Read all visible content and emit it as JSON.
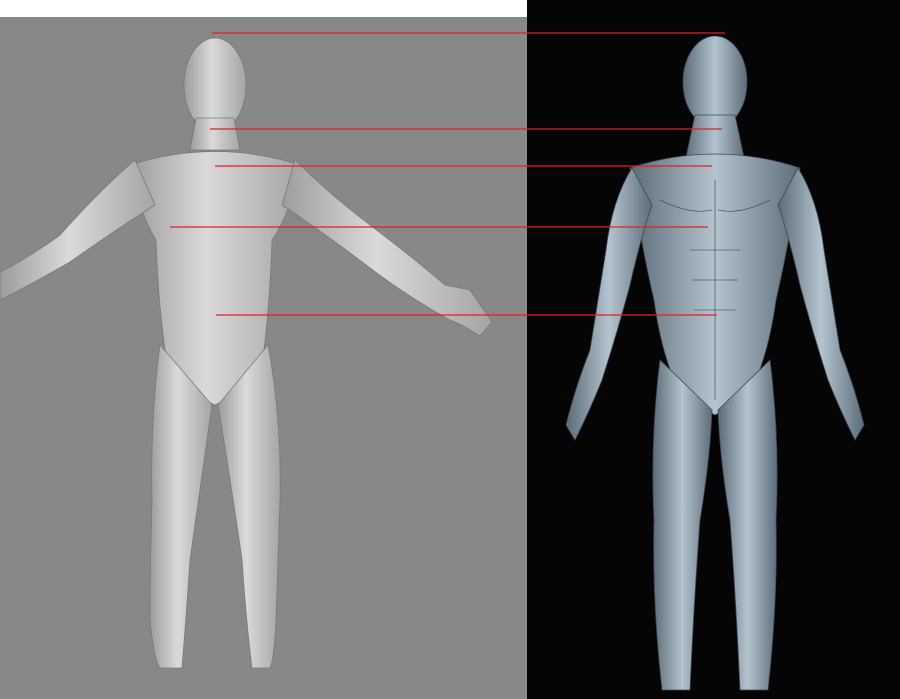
{
  "colors": {
    "left_background": "#888888",
    "left_frame": "#ffffff",
    "right_background": "#050505",
    "reference_line": "#e02020",
    "base_mesh_skin": "#c4c4c4",
    "ecorche_skin": "#8a9aa6"
  },
  "panels": {
    "left": "base-mesh-3d-model",
    "right": "ecorche-muscle-figure"
  },
  "reference_lines": {
    "count": 5,
    "landmarks": [
      "top-of-head",
      "chin",
      "collarbone",
      "chest",
      "navel"
    ]
  }
}
